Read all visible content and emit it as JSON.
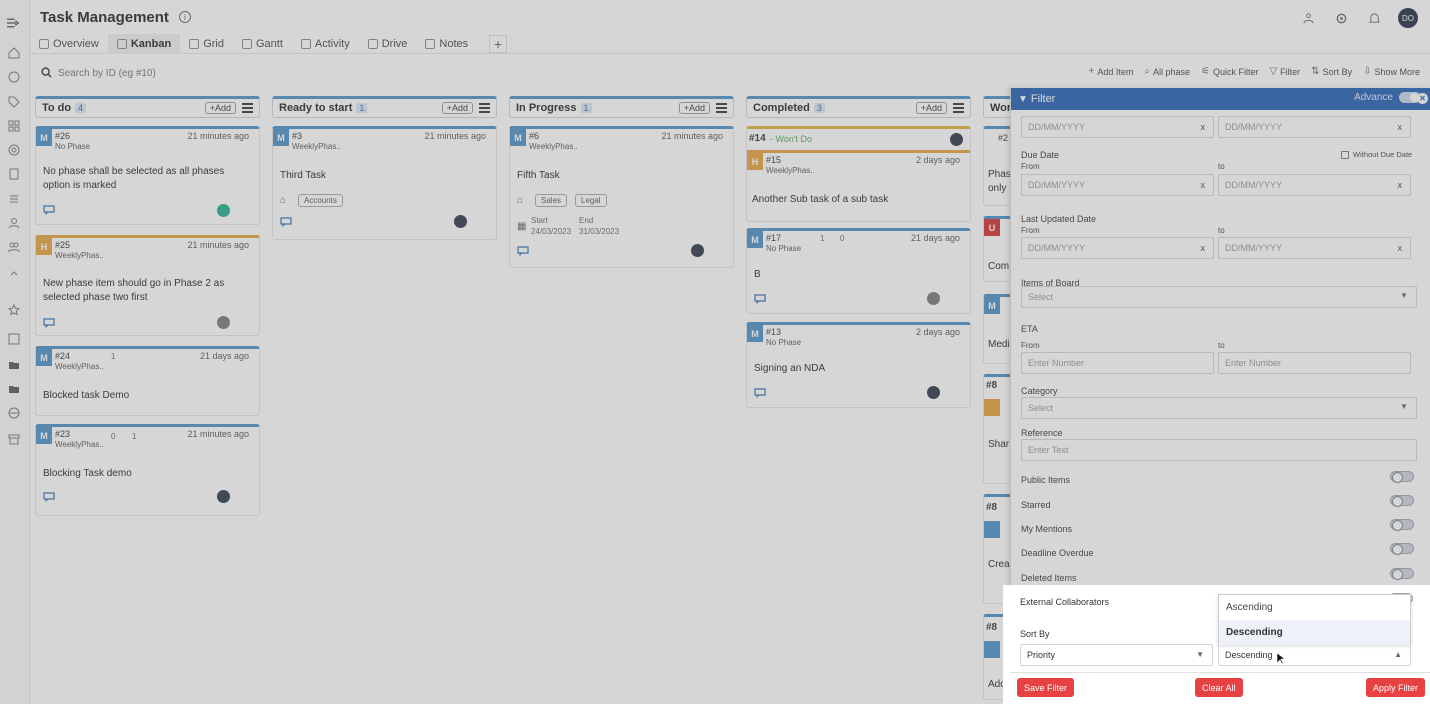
{
  "app": {
    "title": "Task Management",
    "user_initials": "DO"
  },
  "tabs": [
    "Overview",
    "Kanban",
    "Grid",
    "Gantt",
    "Activity",
    "Drive",
    "Notes"
  ],
  "search": {
    "placeholder": "Search by ID (eg #10)"
  },
  "toolbar": [
    "Add Item",
    "All phase",
    "Quick Filter",
    "Filter",
    "Sort By",
    "Show More"
  ],
  "columns": [
    {
      "title": "To do",
      "count": "4",
      "add": "+Add"
    },
    {
      "title": "Ready to start",
      "count": "1",
      "add": "+Add"
    },
    {
      "title": "In Progress",
      "count": "1",
      "add": "+Add"
    },
    {
      "title": "Completed",
      "count": "3",
      "add": "+Add"
    },
    {
      "title": "Wor"
    }
  ],
  "cards": {
    "c26": {
      "badge": "M",
      "id": "#26",
      "sub": "No Phase",
      "time": "21 minutes ago",
      "title": "No phase shall be selected as all phases option is marked"
    },
    "c25": {
      "badge": "H",
      "id": "#25",
      "sub": "WeeklyPhas..",
      "time": "21 minutes ago",
      "title": "New phase item should go in Phase 2 as selected phase two first"
    },
    "c24": {
      "badge": "M",
      "id": "#24",
      "sub": "WeeklyPhas..",
      "time": "21 days ago",
      "title": "Blocked task Demo",
      "meta": "1"
    },
    "c23": {
      "badge": "M",
      "id": "#23",
      "sub": "WeeklyPhas..",
      "time": "21 minutes ago",
      "title": "Blocking Task demo",
      "meta_a": "0",
      "meta_b": "1"
    },
    "c3": {
      "badge": "M",
      "id": "#3",
      "sub": "WeeklyPhas..",
      "time": "21 minutes ago",
      "title": "Third Task",
      "tag": "Accounts"
    },
    "c6": {
      "badge": "M",
      "id": "#6",
      "sub": "WeeklyPhas..",
      "time": "21 minutes ago",
      "title": "Fifth Task",
      "tags": [
        "Sales",
        "Legal"
      ],
      "start_label": "Start",
      "end_label": "End",
      "start": "24/03/2023",
      "end": "31/03/2023"
    },
    "c14": {
      "id": "#14",
      "label": "- Won't Do"
    },
    "c15": {
      "badge": "H",
      "id": "#15",
      "sub": "WeeklyPhas..",
      "time": "2 days ago",
      "title": "Another Sub task of a sub task"
    },
    "c17": {
      "badge": "M",
      "id": "#17",
      "sub": "No Phase",
      "time": "21 days ago",
      "title": "B",
      "meta_a": "1",
      "meta_b": "0"
    },
    "c13": {
      "badge": "M",
      "id": "#13",
      "sub": "No Phase",
      "time": "2 days ago",
      "title": "Signing an NDA"
    },
    "w27": {
      "id": "#2",
      "line1": "Phas",
      "line2": "only"
    },
    "wU": {
      "badge": "U",
      "text": "Com"
    },
    "wM": {
      "badge": "M",
      "text": "Medi"
    },
    "w8a": {
      "id": "#8",
      "text": "Shar"
    },
    "w8b": {
      "id": "#8",
      "text": "Crea"
    },
    "w8c": {
      "id": "#8",
      "text": "Addi"
    }
  },
  "filter": {
    "title": "Filter",
    "advance": "Advance",
    "date_placeholder": "DD/MM/YYYY",
    "due_date": "Due Date",
    "without_due": "Without Due Date",
    "from": "From",
    "to": "to",
    "last_updated": "Last Updated Date",
    "items_of_board": "Items of Board",
    "select": "Select",
    "eta": "ETA",
    "enter_number": "Enter Number",
    "category": "Category",
    "reference": "Reference",
    "enter_text": "Enter Text",
    "toggles": [
      "Public Items",
      "Starred",
      "My Mentions",
      "Deadline Overdue",
      "Deleted Items"
    ],
    "external": "External Collaborators",
    "sort_by": "Sort By",
    "sort_field": "Priority",
    "sort_order": "Descending",
    "options": [
      "Ascending",
      "Descending"
    ],
    "save": "Save Filter",
    "clear": "Clear All",
    "apply": "Apply Filter"
  }
}
